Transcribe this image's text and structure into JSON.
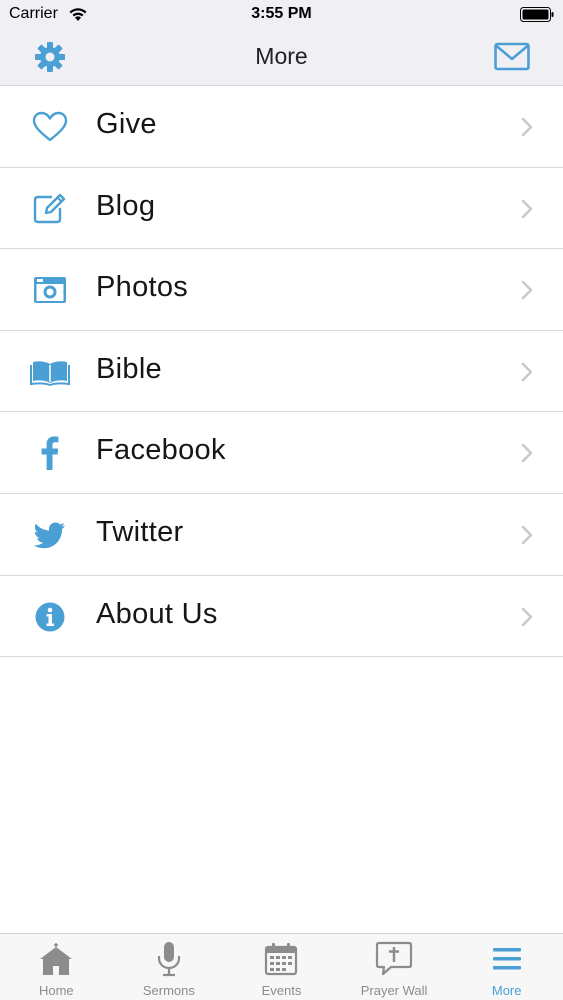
{
  "status_bar": {
    "carrier": "Carrier",
    "time": "3:55 PM"
  },
  "nav": {
    "title": "More",
    "left_icon": "gear-icon",
    "right_icon": "mail-icon"
  },
  "colors": {
    "accent": "#4a9fd4",
    "inactive": "#8c8c8c",
    "chevron": "#c7c7cc"
  },
  "menu": {
    "items": [
      {
        "label": "Give",
        "icon": "heart-icon"
      },
      {
        "label": "Blog",
        "icon": "edit-icon"
      },
      {
        "label": "Photos",
        "icon": "camera-icon"
      },
      {
        "label": "Bible",
        "icon": "book-icon"
      },
      {
        "label": "Facebook",
        "icon": "facebook-icon"
      },
      {
        "label": "Twitter",
        "icon": "twitter-icon"
      },
      {
        "label": "About Us",
        "icon": "info-icon"
      }
    ]
  },
  "tabs": {
    "items": [
      {
        "label": "Home",
        "icon": "home-icon",
        "active": false
      },
      {
        "label": "Sermons",
        "icon": "microphone-icon",
        "active": false
      },
      {
        "label": "Events",
        "icon": "calendar-icon",
        "active": false
      },
      {
        "label": "Prayer Wall",
        "icon": "prayer-icon",
        "active": false
      },
      {
        "label": "More",
        "icon": "menu-icon",
        "active": true
      }
    ]
  }
}
